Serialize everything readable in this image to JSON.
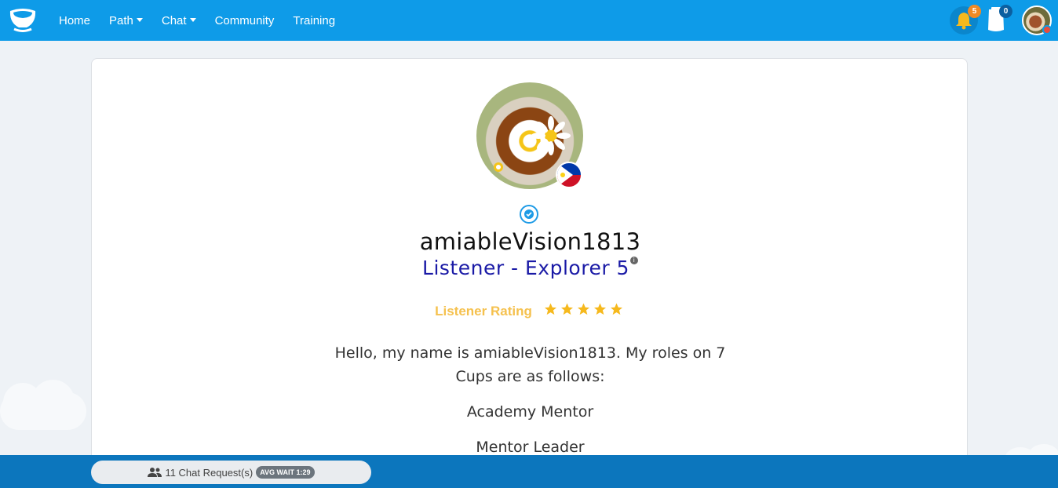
{
  "nav": {
    "links": [
      {
        "label": "Home"
      },
      {
        "label": "Path"
      },
      {
        "label": "Chat"
      },
      {
        "label": "Community"
      },
      {
        "label": "Training"
      }
    ],
    "notifications_count": "5",
    "messages_count": "0",
    "brand_color": "#0e9be8"
  },
  "profile": {
    "username": "amiableVision1813",
    "rank": "Listener - Explorer 5",
    "rating_label": "Listener Rating",
    "rating_stars": 5,
    "country_flag": "philippines-flag-icon",
    "bio_lines": [
      "Hello, my name is amiableVision1813. My roles on 7",
      "Cups are as follows:"
    ],
    "roles": [
      "Academy Mentor",
      "Mentor Leader"
    ]
  },
  "footer": {
    "chat_requests": "11 Chat Request(s)",
    "avg_wait": "AVG WAIT 1:29"
  }
}
